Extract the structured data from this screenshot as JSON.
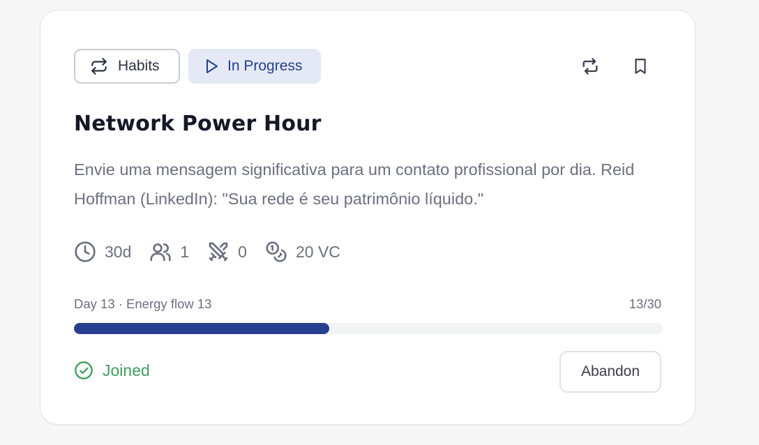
{
  "card": {
    "category_chip": {
      "label": "Habits",
      "icon": "repeat-icon"
    },
    "status_chip": {
      "label": "In Progress",
      "icon": "play-icon"
    },
    "actions": [
      {
        "icon": "retweet-icon"
      },
      {
        "icon": "bookmark-icon"
      }
    ],
    "title": "Network Power Hour",
    "description": "Envie uma mensagem significativa para um contato profissional por dia. Reid Hoffman (LinkedIn): \"Sua rede é seu patrimônio líquido.\"",
    "stats": {
      "duration": "30d",
      "participants": "1",
      "battles": "0",
      "reward": "20 VC"
    },
    "progress": {
      "label": "Day 13 · Energy flow 13",
      "count": "13/30",
      "fraction": 0.4333
    },
    "joined_label": "Joined",
    "abandon_label": "Abandon"
  },
  "colors": {
    "accent": "#26408f",
    "success": "#3f9d5e",
    "muted": "#6b7080"
  }
}
